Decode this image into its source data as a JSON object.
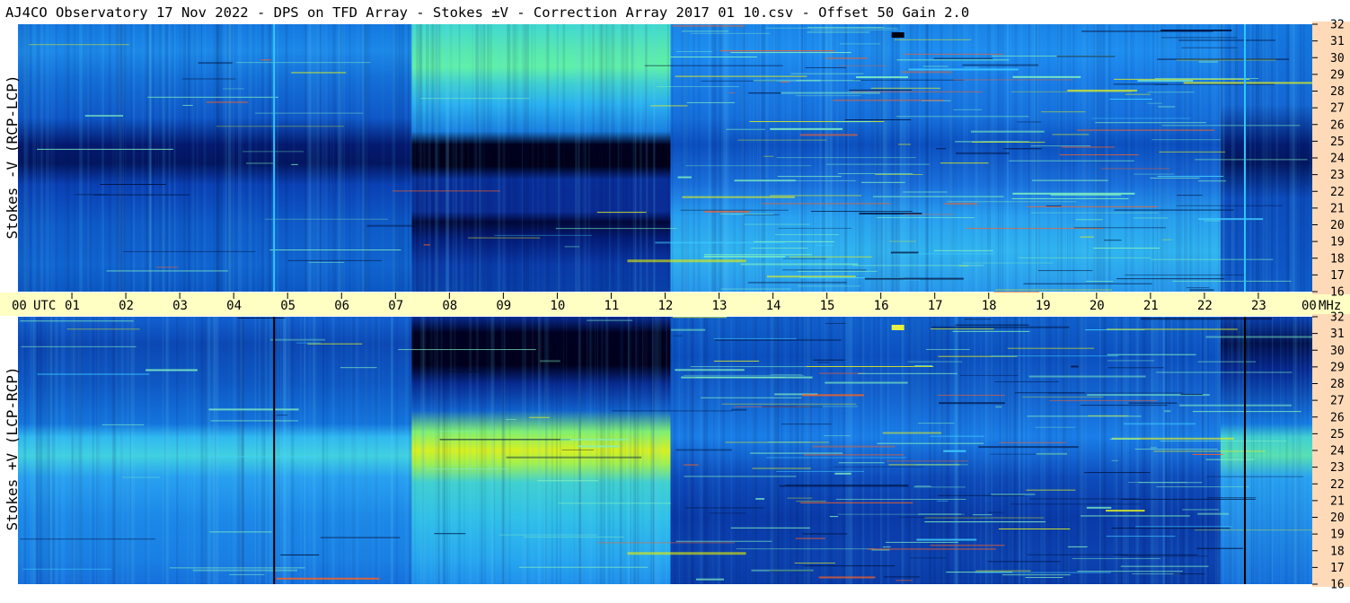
{
  "title": "AJ4CO Observatory  17 Nov 2022  -  DPS on TFD Array  -  Stokes ±V  -  Correction Array 2017 01 10.csv  -  Offset 50  Gain 2.0",
  "colors": {
    "time_strip": "#ffffc4",
    "freq_strip": "#ffdab9",
    "colormap": [
      "#00002a",
      "#001070",
      "#0040d8",
      "#10a0f0",
      "#40e0c0",
      "#e8f000",
      "#ff8800",
      "#ff2020"
    ]
  },
  "chart_data": [
    {
      "type": "heatmap",
      "name": "top",
      "ylabel": "Stokes -V (RCP-LCP)",
      "x_range_hours": [
        0,
        24
      ],
      "y_range_mhz": [
        16,
        32
      ],
      "yticks": [
        "32",
        "31",
        "30",
        "29",
        "28",
        "27",
        "26",
        "25",
        "24",
        "23",
        "22",
        "21",
        "20",
        "19",
        "18",
        "17",
        "16"
      ],
      "vertical_line_hours": [
        4.75,
        22.75
      ],
      "vertical_line_color": "#30c8ff"
    },
    {
      "type": "heatmap",
      "name": "bottom",
      "ylabel": "Stokes +V (LCP-RCP)",
      "x_range_hours": [
        0,
        24
      ],
      "y_range_mhz": [
        16,
        32
      ],
      "yticks": [
        "32",
        "31",
        "30",
        "29",
        "28",
        "27",
        "26",
        "25",
        "24",
        "23",
        "22",
        "21",
        "20",
        "19",
        "18",
        "17",
        "16"
      ],
      "vertical_line_hours": [
        4.75,
        22.75
      ],
      "vertical_line_color": "#000000"
    }
  ],
  "time_axis": {
    "start_label": "00",
    "utc_label": "UTC",
    "ticks": [
      "01",
      "02",
      "03",
      "04",
      "05",
      "06",
      "07",
      "08",
      "09",
      "10",
      "11",
      "12",
      "13",
      "14",
      "15",
      "16",
      "17",
      "18",
      "19",
      "20",
      "21",
      "22",
      "23"
    ],
    "end_label": "00",
    "unit_label": "MHz"
  }
}
